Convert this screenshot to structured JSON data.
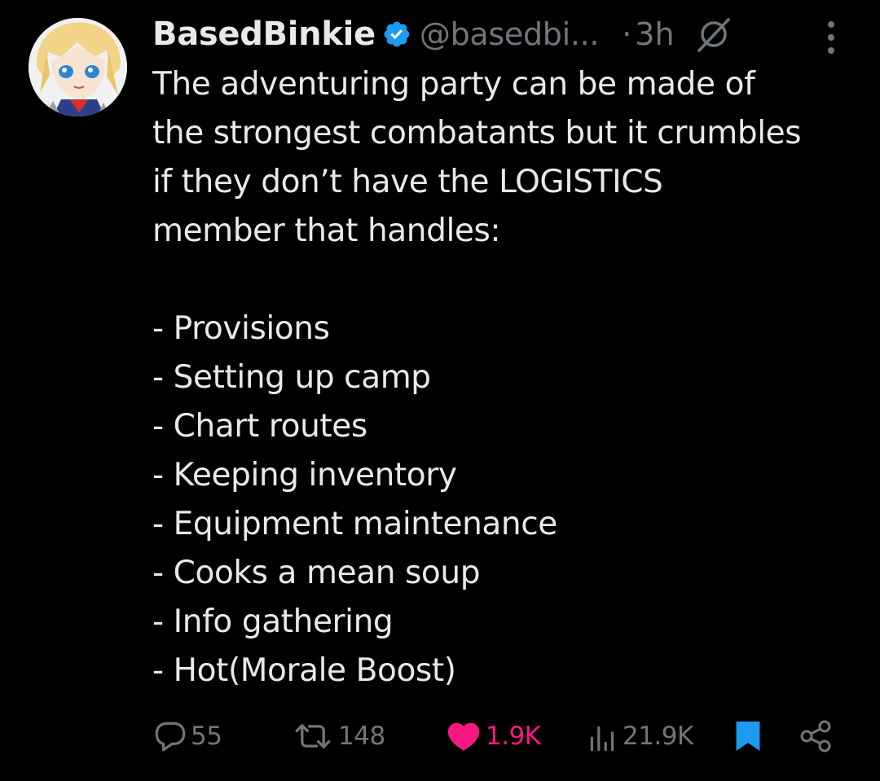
{
  "tweet": {
    "display_name": "BasedBinkie",
    "handle": "@basedbi...",
    "separator": "·",
    "time": "3h",
    "body_lines": [
      "The adventuring party can be made of",
      "the strongest combatants but it crumbles",
      "if they don’t have the LOGISTICS",
      "member that handles:"
    ],
    "list_items": [
      "- Provisions",
      "- Setting up camp",
      "- Chart routes",
      "- Keeping inventory",
      "- Equipment maintenance",
      "- Cooks a mean soup",
      "- Info gathering",
      "- Hot(Morale Boost)"
    ]
  },
  "actions": {
    "replies": "55",
    "reposts": "148",
    "likes": "1.9K",
    "views": "21.9K"
  },
  "icons": {
    "verified": "verified-badge-icon",
    "grok": "grok-icon",
    "more": "more-options-icon",
    "reply": "reply-icon",
    "repost": "repost-icon",
    "like": "heart-icon",
    "views": "views-icon",
    "bookmark": "bookmark-icon",
    "share": "share-icon"
  },
  "colors": {
    "background": "#000000",
    "text": "#e7e9ea",
    "secondary": "#71767b",
    "verified": "#1d9bf0",
    "like": "#f91880",
    "bookmark": "#1d9bf0"
  }
}
